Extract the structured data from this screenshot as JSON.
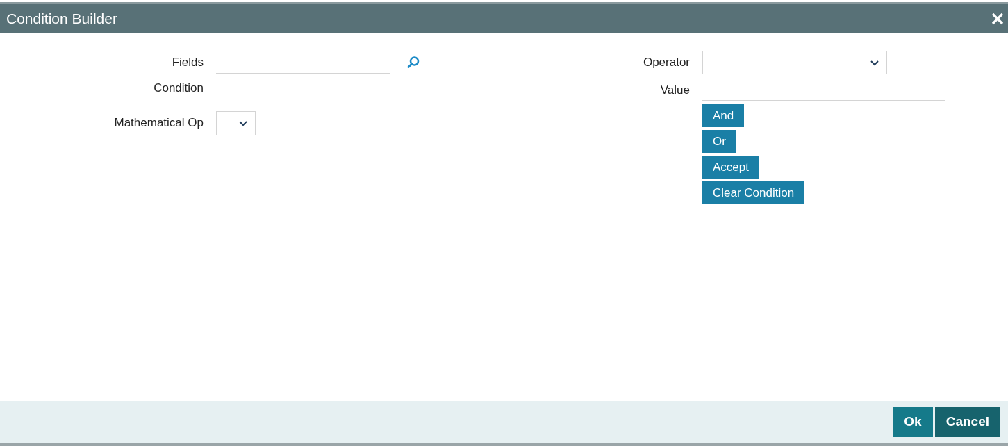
{
  "window": {
    "title": "Condition Builder"
  },
  "left_fields": [
    {
      "label": "Fields",
      "kind": "lookup"
    },
    {
      "label": "Condition",
      "kind": "text"
    },
    {
      "label": "Mathematical Op",
      "kind": "select"
    }
  ],
  "right_fields": [
    {
      "label": "Operator",
      "kind": "select"
    },
    {
      "label": "Value",
      "kind": "text"
    }
  ],
  "condition_buttons": [
    "And",
    "Or",
    "Accept",
    "Clear Condition"
  ],
  "footer_buttons": [
    {
      "label": "Ok",
      "kind": "primary"
    },
    {
      "label": "Cancel",
      "kind": "secondary"
    }
  ]
}
